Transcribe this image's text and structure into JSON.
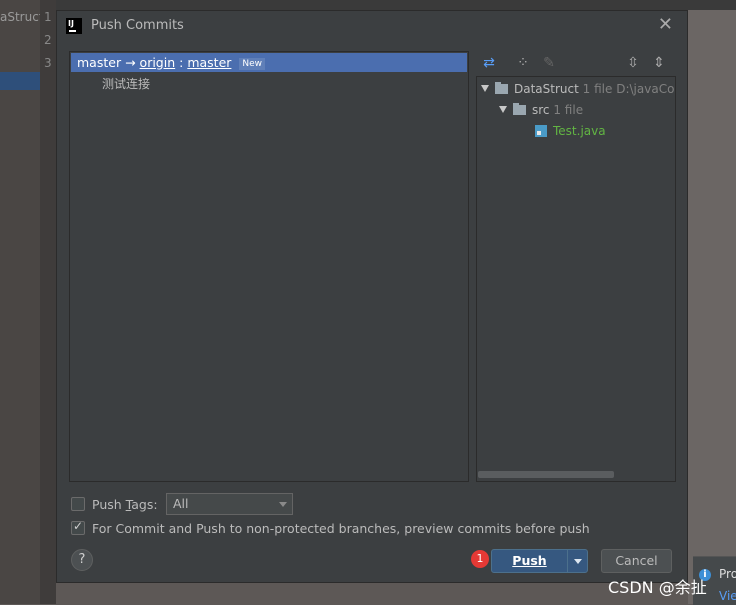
{
  "background": {
    "project_fragment": "aStruct",
    "line_numbers": [
      "1",
      "2",
      "3"
    ],
    "notification": {
      "icon": "info-icon",
      "text": "Pro",
      "link": "Vie"
    }
  },
  "dialog": {
    "title": "Push Commits",
    "app_icon": "intellij-icon",
    "commits": {
      "branch": {
        "local": "master",
        "arrow": "→",
        "remote": "origin",
        "separator": ":",
        "remote_branch": "master",
        "badge": "New"
      },
      "items": [
        "测试连接"
      ]
    },
    "changes": {
      "toolbar_icons": [
        "diff-icon",
        "group-by-icon",
        "edit-icon",
        "expand-all-icon",
        "collapse-all-icon"
      ],
      "tree": {
        "root": {
          "name": "DataStruct",
          "count": "1 file",
          "path": "D:\\javaCod"
        },
        "folder": {
          "name": "src",
          "count": "1 file"
        },
        "file": {
          "name": "Test.java"
        }
      }
    },
    "options": {
      "push_tags_label_pre": "Push ",
      "push_tags_mnemonic": "T",
      "push_tags_label_post": "ags:",
      "push_tags_checked": false,
      "tags_select_value": "All",
      "preview_label": "For Commit and Push to non-protected branches, preview commits before push",
      "preview_checked": true
    },
    "buttons": {
      "help": "?",
      "marker": "1",
      "push": "Push",
      "cancel": "Cancel"
    },
    "colors": {
      "accent": "#4b6eaf",
      "push_button": "#365880",
      "added_file": "#62b543",
      "marker": "#e53935"
    }
  },
  "watermark": "CSDN @余扯"
}
